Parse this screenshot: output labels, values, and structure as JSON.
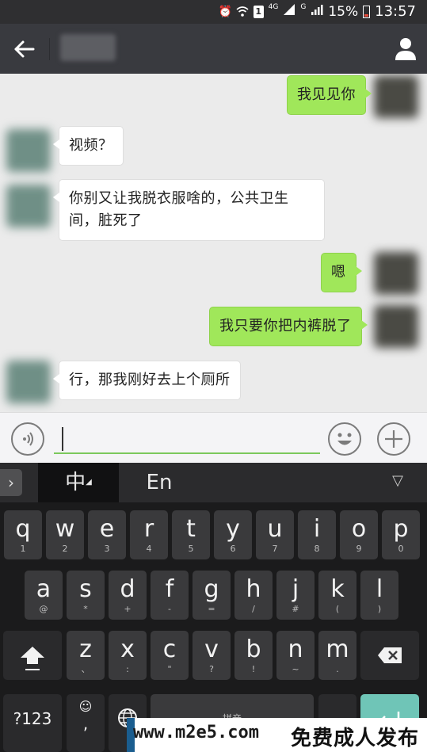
{
  "status_bar": {
    "alarm_icon": "alarm-icon",
    "wifi_icon": "wifi-icon",
    "sim_label": "1",
    "net1_label": "4G",
    "net2_label": "G",
    "battery": "15%",
    "time": "13:57"
  },
  "header": {
    "title": "",
    "back_icon": "back-arrow-icon",
    "profile_icon": "person-icon"
  },
  "messages": [
    {
      "side": "right",
      "text": "我见见你"
    },
    {
      "side": "left",
      "text": "视频？"
    },
    {
      "side": "left",
      "text": "你别又让我脱衣服啥的，公共卫生间，脏死了"
    },
    {
      "side": "right",
      "text": "嗯"
    },
    {
      "side": "right",
      "text": "我只要你把内裤脱了"
    },
    {
      "side": "left",
      "text": "行，那我刚好去上个厕所"
    }
  ],
  "input_bar": {
    "value": "",
    "voice_icon": "voice-icon",
    "emoji_icon": "emoji-icon",
    "plus_icon": "plus-icon"
  },
  "keyboard": {
    "tab_zh": "中",
    "tab_en": "En",
    "row1": [
      {
        "k": "q",
        "s": "1"
      },
      {
        "k": "w",
        "s": "2"
      },
      {
        "k": "e",
        "s": "3"
      },
      {
        "k": "r",
        "s": "4"
      },
      {
        "k": "t",
        "s": "5"
      },
      {
        "k": "y",
        "s": "6"
      },
      {
        "k": "u",
        "s": "7"
      },
      {
        "k": "i",
        "s": "8"
      },
      {
        "k": "o",
        "s": "9"
      },
      {
        "k": "p",
        "s": "0"
      }
    ],
    "row2": [
      {
        "k": "a",
        "s": "@"
      },
      {
        "k": "s",
        "s": "*"
      },
      {
        "k": "d",
        "s": "+"
      },
      {
        "k": "f",
        "s": "-"
      },
      {
        "k": "g",
        "s": "="
      },
      {
        "k": "h",
        "s": "/"
      },
      {
        "k": "j",
        "s": "#"
      },
      {
        "k": "k",
        "s": "("
      },
      {
        "k": "l",
        "s": ")"
      }
    ],
    "row3": [
      {
        "k": "z",
        "s": "、"
      },
      {
        "k": "x",
        "s": ":"
      },
      {
        "k": "c",
        "s": "\""
      },
      {
        "k": "v",
        "s": "?"
      },
      {
        "k": "b",
        "s": "!"
      },
      {
        "k": "n",
        "s": "~"
      },
      {
        "k": "m",
        "s": "."
      }
    ],
    "num_label": "?123",
    "space_label": "拼音"
  },
  "watermark": {
    "url": "www.m2e5.com",
    "text": "免费成人发布"
  }
}
